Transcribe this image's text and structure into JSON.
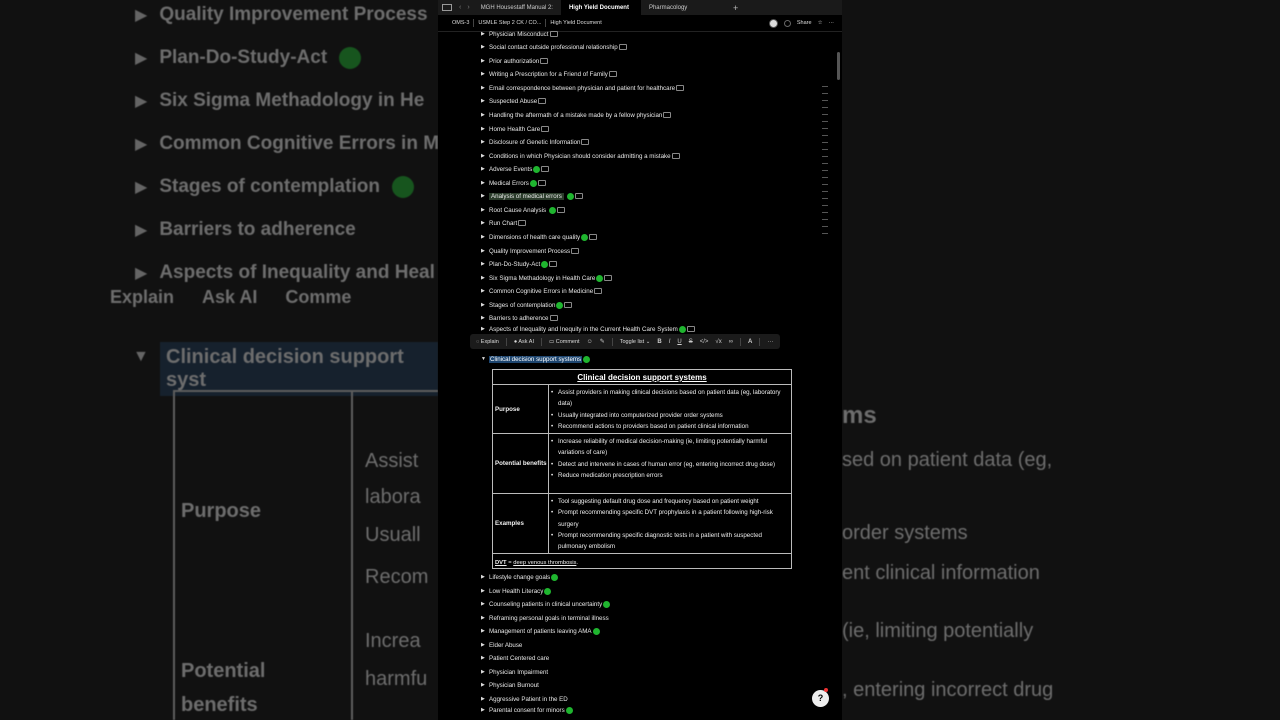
{
  "tabs": [
    {
      "label": "MGH Housestaff Manual 2:"
    },
    {
      "label": "High Yield Document"
    },
    {
      "label": "Pharmacology"
    }
  ],
  "breadcrumbs": [
    "OMS-3",
    "USMLE Step 2 CK / CO...",
    "High Yield Document"
  ],
  "header": {
    "share_label": "Share"
  },
  "items": [
    {
      "label": "Physician Misconduct",
      "dot": false,
      "note": true
    },
    {
      "label": "Social contact outside professional relationship",
      "dot": false,
      "note": true
    },
    {
      "label": "Prior authorization",
      "dot": false,
      "note": true
    },
    {
      "label": "Writing a Prescription for a Friend of Family",
      "dot": false,
      "note": true
    },
    {
      "label": "Email correspondence between physician and patient for healthcare",
      "dot": false,
      "note": true
    },
    {
      "label": "Suspected Abuse",
      "dot": false,
      "note": true
    },
    {
      "label": "Handling the aftermath of a mistake made by a fellow physician",
      "dot": false,
      "note": true
    },
    {
      "label": "Home Health Care",
      "dot": false,
      "note": true
    },
    {
      "label": "Disclosure of Genetic Information",
      "dot": false,
      "note": true
    },
    {
      "label": "Conditions in which Physician should consider admitting a mistake",
      "dot": false,
      "note": true
    },
    {
      "label": "Adverse Events",
      "dot": true,
      "note": true
    },
    {
      "label": "Medical Errors",
      "dot": true,
      "note": true
    },
    {
      "label": "Analysis of medical errors",
      "dot": true,
      "note": true
    },
    {
      "label": "Root Cause Analysis",
      "dot": true,
      "note": true
    },
    {
      "label": "Run Chart",
      "dot": false,
      "note": true
    },
    {
      "label": "Dimensions of health care quality",
      "dot": true,
      "note": true
    },
    {
      "label": "Quality Improvement Process",
      "dot": false,
      "note": true
    },
    {
      "label": "Plan-Do-Study-Act",
      "dot": true,
      "note": true
    },
    {
      "label": "Six Sigma Methadology in Health Care",
      "dot": true,
      "note": true
    },
    {
      "label": "Common Cognitive Errors in Medicine",
      "dot": false,
      "note": true
    },
    {
      "label": "Stages of contemplation",
      "dot": true,
      "note": true
    },
    {
      "label": "Barriers to adherence",
      "dot": false,
      "note": true
    },
    {
      "label": "Aspects of Inequality and Inequity in the Current Health Care System",
      "dot": true,
      "note": true
    }
  ],
  "toolbar": {
    "explain": "Explain",
    "ask_ai": "Ask AI",
    "comment": "Comment",
    "toggle_list": "Toggle list",
    "bold": "B",
    "italic": "I",
    "underline": "U",
    "strike": "S",
    "code": "</>",
    "math": "√x",
    "text_color": "A"
  },
  "expanded": {
    "label": "Clinical decision support systems"
  },
  "table": {
    "title": "Clinical decision support systems",
    "rows": [
      {
        "head": "Purpose",
        "bullets": [
          "Assist providers in making clinical decisions based on patient data (eg, laboratory data)",
          "Usually integrated into computerized provider order systems",
          "Recommend actions to providers based on patient clinical information"
        ]
      },
      {
        "head": "Potential benefits",
        "bullets": [
          "Increase reliability of medical decision-making (ie, limiting potentially harmful variations of care)",
          "Detect and intervene in cases of human error (eg, entering incorrect drug dose)",
          "Reduce medication prescription errors"
        ]
      },
      {
        "head": "Examples",
        "bullets": [
          "Tool suggesting default drug dose and frequency based on patient weight",
          "Prompt recommending specific DVT prophylaxis in a patient following high-risk surgery",
          "Prompt recommending specific diagnostic tests in a patient with suspected pulmonary embolism"
        ]
      }
    ],
    "footnote_abbr": "DVT",
    "footnote_eq": " = ",
    "footnote_def": "deep venous thrombosis",
    "footnote_end": "."
  },
  "items_after": [
    {
      "label": "Lifestyle change goals",
      "dot": true
    },
    {
      "label": "Low Health Literacy",
      "dot": true
    },
    {
      "label": "Counseling patients in clinical uncertainty",
      "dot": true
    },
    {
      "label": "Reframing personal goals in terminal illness",
      "dot": false
    },
    {
      "label": "Management of patients leaving AMA",
      "dot": true
    },
    {
      "label": "Elder Abuse",
      "dot": false
    },
    {
      "label": "Patient Centered care",
      "dot": false
    },
    {
      "label": "Physician Impairment",
      "dot": false
    },
    {
      "label": "Physician Burnout",
      "dot": false
    },
    {
      "label": "Aggressive Patient in the ED",
      "dot": false
    },
    {
      "label": "Parental consent for minors",
      "dot": true
    }
  ],
  "bg": {
    "left_lines": [
      "Quality Improvement Process",
      "Plan-Do-Study-Act",
      "Six Sigma Methadology in He",
      "Common Cognitive Errors in M",
      "Stages of contemplation",
      "Barriers to adherence",
      "Aspects of Inequality and Heal"
    ],
    "toolbar": [
      "Explain",
      "Ask AI",
      "Comme"
    ],
    "sel": "Clinical decision support syst",
    "purpose": "Purpose",
    "benefits": "Potential benefits",
    "purpose_lines": [
      "Assist",
      "labora",
      "Usuall",
      "Recom"
    ],
    "benefit_lines": [
      "Increa",
      "harmfu",
      "Detec"
    ],
    "right_lines": [
      "sed on patient data (eg,",
      "order systems",
      "ent clinical information",
      "(ie, limiting potentially",
      ", entering incorrect drug"
    ],
    "right_title": "ms"
  },
  "colors": {
    "green_dot": "#1fb52f",
    "selection": "#1e4670"
  }
}
